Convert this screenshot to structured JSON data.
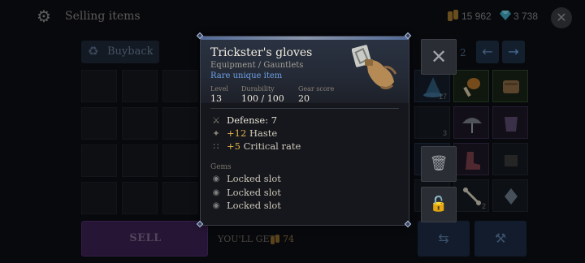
{
  "header": {
    "title": "Selling items",
    "gold": "15 962",
    "gems": "3 738"
  },
  "left_panel": {
    "buyback_label": "Buyback",
    "sell_label": "SELL",
    "youll_get_label": "YOU'LL GET",
    "youll_get_amount": "74"
  },
  "right_panel": {
    "page": "2",
    "item_counts": [
      "17",
      "3",
      "2"
    ]
  },
  "tooltip": {
    "name": "Trickster's gloves",
    "type": "Equipment / Gauntlets",
    "rarity": "Rare unique item",
    "stats": {
      "level_label": "Level",
      "level": "13",
      "durability_label": "Durability",
      "durability": "100 / 100",
      "gear_score_label": "Gear score",
      "gear_score": "20"
    },
    "defense": "Defense: 7",
    "bonuses": [
      {
        "value": "+12",
        "name": "Haste"
      },
      {
        "value": "+5",
        "name": "Critical rate"
      }
    ],
    "gems_title": "Gems",
    "gem_slots": [
      "Locked slot",
      "Locked slot",
      "Locked slot"
    ]
  },
  "colors": {
    "rarity_blue": "#6ea0e6",
    "bonus_gold": "#e0b24a",
    "sell_purple": "#3b2152"
  },
  "icons": {
    "sell": "sell-bag-icon",
    "gold": "gold-coin-icon",
    "gems": "diamond-icon",
    "close": "close-icon",
    "buyback": "buyback-icon",
    "trash": "trash-icon",
    "unlock": "unlock-icon",
    "defense": "defense-swords-icon",
    "haste": "haste-icon",
    "crit": "critical-rate-icon",
    "gem_slot": "locked-gem-slot-icon"
  }
}
